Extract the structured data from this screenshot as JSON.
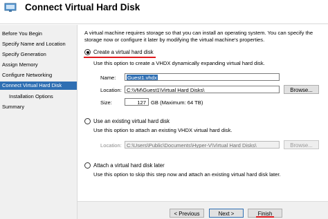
{
  "window": {
    "title": "Connect Virtual Hard Disk",
    "icon": "wizard-monitor-icon"
  },
  "nav": {
    "items": [
      {
        "label": "Before You Begin",
        "active": false,
        "sub": false
      },
      {
        "label": "Specify Name and Location",
        "active": false,
        "sub": false
      },
      {
        "label": "Specify Generation",
        "active": false,
        "sub": false
      },
      {
        "label": "Assign Memory",
        "active": false,
        "sub": false
      },
      {
        "label": "Configure Networking",
        "active": false,
        "sub": false
      },
      {
        "label": "Connect Virtual Hard Disk",
        "active": true,
        "sub": false
      },
      {
        "label": "Installation Options",
        "active": false,
        "sub": true
      },
      {
        "label": "Summary",
        "active": false,
        "sub": false
      }
    ]
  },
  "content": {
    "description": "A virtual machine requires storage so that you can install an operating system. You can specify the storage now or configure it later by modifying the virtual machine's properties.",
    "create": {
      "label": "Create a virtual hard disk",
      "checked": true,
      "description": "Use this option to create a VHDX dynamically expanding virtual hard disk.",
      "name_label": "Name:",
      "name_value": "Guest1.vhdx",
      "location_label": "Location:",
      "location_value": "C:\\VM\\Guest1\\Virtual Hard Disks\\",
      "browse_label": "Browse...",
      "size_label": "Size:",
      "size_value": "127",
      "size_unit": "GB (Maximum: 64 TB)"
    },
    "existing": {
      "label": "Use an existing virtual hard disk",
      "checked": false,
      "description": "Use this option to attach an existing VHDX virtual hard disk.",
      "location_label": "Location:",
      "location_value": "C:\\Users\\Public\\Documents\\Hyper-V\\Virtual Hard Disks\\",
      "browse_label": "Browse..."
    },
    "later": {
      "label": "Attach a virtual hard disk later",
      "checked": false,
      "description": "Use this option to skip this step now and attach an existing virtual hard disk later."
    }
  },
  "footer": {
    "previous_label": "< Previous",
    "next_label": "Next >",
    "finish_label": "Finish"
  },
  "colors": {
    "selection": "#2f6fb3",
    "highlight_underline": "#e0181c"
  }
}
